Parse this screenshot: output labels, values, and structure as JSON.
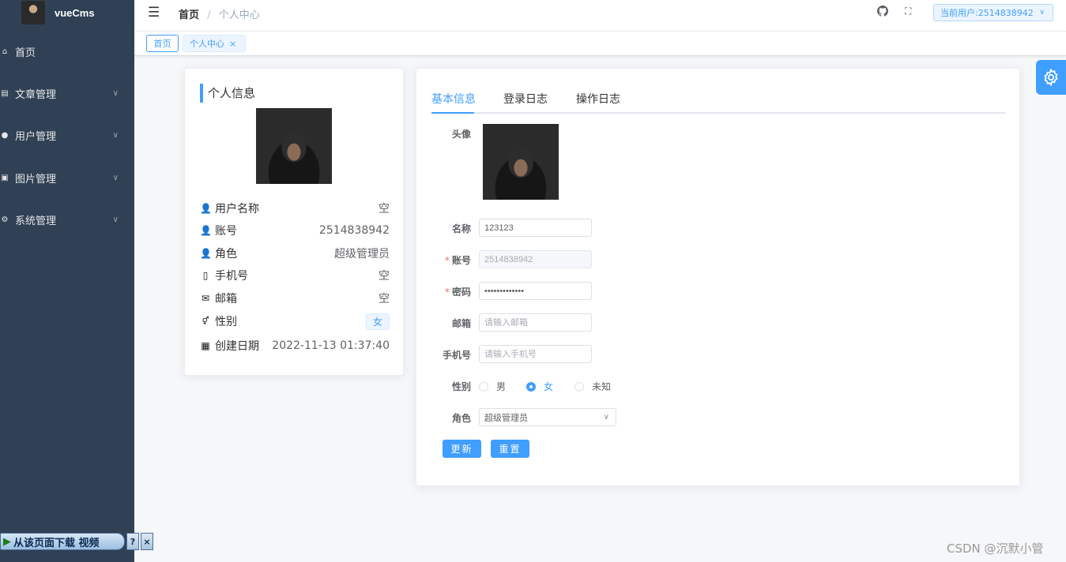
{
  "app": {
    "title": "vueCms"
  },
  "sidebar": {
    "items": [
      {
        "label": "首页",
        "icon": "home-icon",
        "expandable": false
      },
      {
        "label": "文章管理",
        "icon": "document-icon",
        "expandable": true
      },
      {
        "label": "用户管理",
        "icon": "user-icon",
        "expandable": true
      },
      {
        "label": "图片管理",
        "icon": "picture-icon",
        "expandable": true
      },
      {
        "label": "系统管理",
        "icon": "gear-icon",
        "expandable": true
      }
    ]
  },
  "header": {
    "breadcrumb": {
      "home": "首页",
      "separator": "/",
      "current": "个人中心"
    },
    "current_user_label": "当前用户:2514838942"
  },
  "tags": {
    "home": "首页",
    "active": "个人中心",
    "close_glyph": "×"
  },
  "profile": {
    "title": "个人信息",
    "rows": [
      {
        "label": "用户名称",
        "value": "空",
        "icon": "user-icon"
      },
      {
        "label": "账号",
        "value": "2514838942",
        "icon": "user-icon"
      },
      {
        "label": "角色",
        "value": "超级管理员",
        "icon": "user-icon"
      },
      {
        "label": "手机号",
        "value": "空",
        "icon": "phone-icon"
      },
      {
        "label": "邮箱",
        "value": "空",
        "icon": "mail-icon"
      },
      {
        "label": "性别",
        "value": "女",
        "icon": "gender-icon"
      },
      {
        "label": "创建日期",
        "value": "2022-11-13 01:37:40",
        "icon": "calendar-icon"
      }
    ]
  },
  "tabs": [
    {
      "label": "基本信息",
      "active": true
    },
    {
      "label": "登录日志",
      "active": false
    },
    {
      "label": "操作日志",
      "active": false
    }
  ],
  "form": {
    "avatar_label": "头像",
    "name": {
      "label": "名称",
      "value": "123123"
    },
    "account": {
      "label": "账号",
      "value": "2514838942",
      "required": true
    },
    "password": {
      "label": "密码",
      "value": "•••••••••••••",
      "required": true
    },
    "email": {
      "label": "邮箱",
      "placeholder": "请输入邮箱"
    },
    "phone": {
      "label": "手机号",
      "placeholder": "请输入手机号"
    },
    "gender": {
      "label": "性别",
      "options": [
        "男",
        "女",
        "未知"
      ],
      "selected": "女"
    },
    "role": {
      "label": "角色",
      "value": "超级管理员"
    },
    "update_button": "更新",
    "reset_button": "重置"
  },
  "download_bar": {
    "label": "从该页面下载 视频",
    "help": "?",
    "close": "×"
  },
  "watermark": "CSDN @沉默小管",
  "colors": {
    "primary": "#409eff",
    "sidebar_bg": "#304156",
    "danger": "#f56c6c"
  }
}
